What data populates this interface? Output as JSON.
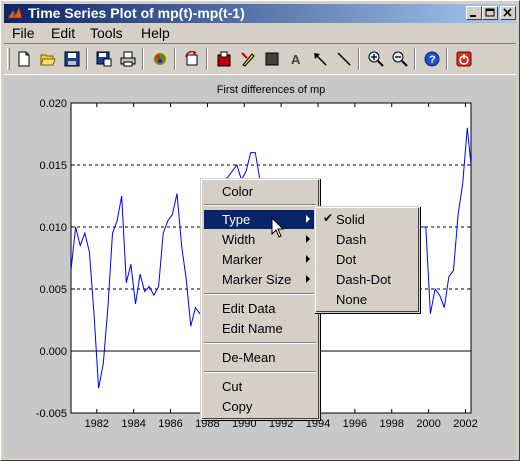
{
  "window": {
    "title": "Time Series Plot of mp(t)-mp(t-1)"
  },
  "menubar": {
    "items": [
      "File",
      "Edit",
      "Tools",
      "Help"
    ]
  },
  "toolbar": {
    "buttons": [
      "new-icon",
      "open-icon",
      "save-icon",
      "save-copy-icon",
      "print-icon",
      "colormap-icon",
      "rotate-icon",
      "export-icon",
      "insert-edit-icon",
      "rectangle-icon",
      "text-icon",
      "arrow-icon",
      "line-icon",
      "zoom-in-icon",
      "zoom-out-icon",
      "help-icon",
      "exit-icon"
    ]
  },
  "axes": {
    "title": "First differences of mp",
    "yticks": [
      "0.020",
      "0.015",
      "0.010",
      "0.005",
      "0.000",
      "-0.005"
    ],
    "xticks": [
      "1982",
      "1984",
      "1986",
      "1988",
      "1990",
      "1992",
      "1994",
      "1996",
      "1998",
      "2000",
      "2002"
    ]
  },
  "chart_data": {
    "type": "line",
    "title": "First differences of mp",
    "xlabel": "",
    "ylabel": "",
    "xlim": [
      1980.6,
      2002.3
    ],
    "ylim": [
      -0.005,
      0.02
    ],
    "grid": "dashed horizontal at 0.005, 0.010, 0.015",
    "reference_line": 0.0,
    "series": [
      {
        "color": "#0000ff",
        "x": [
          1980.6,
          1980.85,
          1981.1,
          1981.35,
          1981.6,
          1981.85,
          1982.1,
          1982.35,
          1982.6,
          1982.85,
          1983.1,
          1983.35,
          1983.6,
          1983.85,
          1984.1,
          1984.35,
          1984.6,
          1984.85,
          1985.1,
          1985.35,
          1985.6,
          1985.85,
          1986.1,
          1986.35,
          1986.6,
          1986.85,
          1987.1,
          1987.35,
          1987.6,
          1987.85,
          1988.1,
          1988.35,
          1988.6,
          1988.85,
          1989.1,
          1989.35,
          1989.6,
          1989.85,
          1990.1,
          1990.35,
          1990.6,
          1990.85,
          1991.1,
          1991.35,
          1991.6,
          1991.85,
          1992.1,
          1992.35,
          1992.6,
          1992.85,
          1993.1,
          1993.35,
          1993.6,
          1993.85,
          1994.1,
          1994.35,
          1994.6,
          1994.85,
          1995.1,
          1995.35,
          1995.6,
          1995.85,
          1996.1,
          1996.35,
          1996.6,
          1996.85,
          1997.1,
          1997.35,
          1997.6,
          1997.85,
          1998.1,
          1998.35,
          1998.6,
          1998.85,
          1999.1,
          1999.35,
          1999.6,
          1999.85,
          2000.1,
          2000.35,
          2000.6,
          2000.85,
          2001.1,
          2001.35,
          2001.6,
          2001.85,
          2002.1,
          2002.3
        ],
        "values": [
          0.0065,
          0.01,
          0.0085,
          0.0095,
          0.008,
          0.003,
          -0.003,
          -0.001,
          0.0035,
          0.0095,
          0.0105,
          0.0125,
          0.0055,
          0.007,
          0.0038,
          0.0062,
          0.0048,
          0.0052,
          0.0045,
          0.0052,
          0.0095,
          0.0105,
          0.011,
          0.0127,
          0.0085,
          0.0058,
          0.002,
          0.0035,
          0.003,
          0.0045,
          0.0075,
          0.0115,
          0.0135,
          0.0138,
          0.014,
          0.0145,
          0.015,
          0.0138,
          0.0145,
          0.016,
          0.016,
          0.0138,
          0.013,
          0.011,
          0.009,
          0.006,
          0.005,
          0.004,
          0.003,
          0.002,
          0.001,
          0.0012,
          0.002,
          0.003,
          0.0035,
          0.004,
          0.005,
          0.005,
          0.0045,
          0.0055,
          0.006,
          0.005,
          0.0055,
          0.006,
          0.005,
          0.007,
          0.0065,
          0.008,
          0.0085,
          0.0095,
          0.0115,
          0.011,
          0.01,
          0.01,
          0.0095,
          0.0105,
          0.01,
          0.01,
          0.003,
          0.005,
          0.0045,
          0.0035,
          0.006,
          0.0065,
          0.011,
          0.0135,
          0.018,
          0.015
        ]
      }
    ]
  },
  "context_menu": {
    "items": [
      {
        "label": "Color"
      },
      {
        "label": "Type",
        "submenu": true,
        "highlighted": true
      },
      {
        "label": "Width",
        "submenu": true
      },
      {
        "label": "Marker",
        "submenu": true
      },
      {
        "label": "Marker Size",
        "submenu": true
      },
      {
        "label": "Edit Data"
      },
      {
        "label": "Edit Name"
      },
      {
        "label": "De-Mean"
      },
      {
        "label": "Cut"
      },
      {
        "label": "Copy"
      }
    ]
  },
  "submenu": {
    "items": [
      {
        "label": "Solid",
        "checked": true
      },
      {
        "label": "Dash"
      },
      {
        "label": "Dot"
      },
      {
        "label": "Dash-Dot"
      },
      {
        "label": "None"
      }
    ],
    "check_glyph": "✔"
  }
}
